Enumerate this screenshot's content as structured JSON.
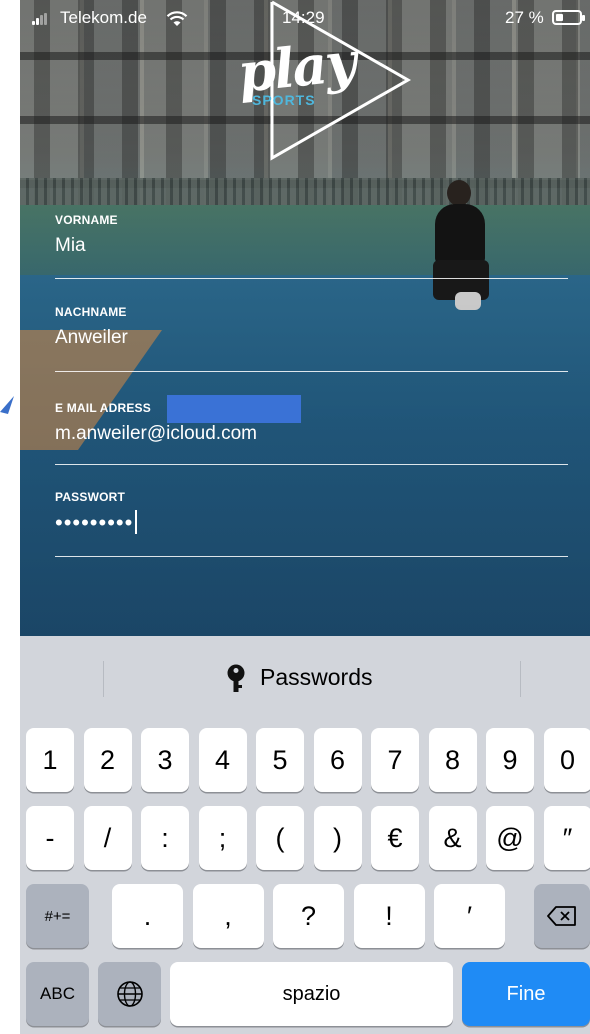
{
  "status_bar": {
    "carrier": "Telekom.de",
    "time": "14:29",
    "battery_percent": "27 %"
  },
  "logo": {
    "main": "play",
    "sub": "SPORTS"
  },
  "form": {
    "first_name": {
      "label": "VORNAME",
      "value": "Mia"
    },
    "last_name": {
      "label": "NACHNAME",
      "value": "Anweiler"
    },
    "email": {
      "label": "E MAIL ADRESS",
      "value": "m.anweiler@icloud.com"
    },
    "password": {
      "label": "PASSWORT",
      "value": "•••••••••"
    }
  },
  "keyboard": {
    "suggestion": "Passwords",
    "row1": [
      "1",
      "2",
      "3",
      "4",
      "5",
      "6",
      "7",
      "8",
      "9",
      "0"
    ],
    "row2": [
      "-",
      "/",
      ":",
      ";",
      "(",
      ")",
      "€",
      "&",
      "@",
      "″"
    ],
    "row3_left": "#+=",
    "row3": [
      ".",
      ",",
      "?",
      "!",
      "′"
    ],
    "abc": "ABC",
    "space": "spazio",
    "return": "Fine"
  },
  "colors": {
    "accent_blue": "#1f8bf5",
    "logo_sub": "#4fb7dc",
    "redaction": "#3a72d6",
    "keyboard_bg": "#d2d5db"
  }
}
